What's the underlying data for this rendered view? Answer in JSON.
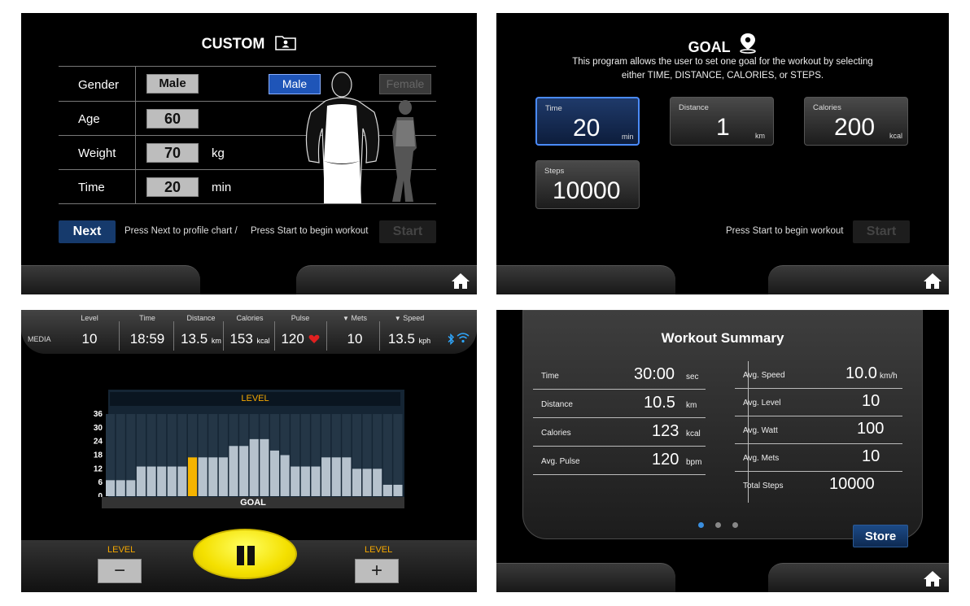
{
  "custom": {
    "title": "CUSTOM",
    "labels": {
      "gender": "Gender",
      "age": "Age",
      "weight": "Weight",
      "time": "Time"
    },
    "values": {
      "gender": "Male",
      "age": "60",
      "weight": "70",
      "time": "20"
    },
    "units": {
      "weight": "kg",
      "time": "min"
    },
    "gender_options": {
      "male": "Male",
      "female": "Female"
    },
    "next_label": "Next",
    "hint_next": "Press Next to profile chart  /",
    "hint_start": "Press Start to begin workout",
    "start_label": "Start"
  },
  "goal": {
    "title": "GOAL",
    "description_line1": "This program allows the user to set one goal for the workout by selecting",
    "description_line2": "either TIME, DISTANCE, CALORIES, or STEPS.",
    "cards": [
      {
        "label": "Time",
        "value": "20",
        "unit": "min",
        "selected": true
      },
      {
        "label": "Distance",
        "value": "1",
        "unit": "km",
        "selected": false
      },
      {
        "label": "Calories",
        "value": "200",
        "unit": "kcal",
        "selected": false
      },
      {
        "label": "Steps",
        "value": "10000",
        "unit": "",
        "selected": false
      }
    ],
    "hint_start": "Press Start to begin workout",
    "start_label": "Start"
  },
  "workout": {
    "media_label": "MEDIA",
    "stats": [
      {
        "label": "Level",
        "value": "10",
        "unit": ""
      },
      {
        "label": "Time",
        "value": "18:59",
        "unit": ""
      },
      {
        "label": "Distance",
        "value": "13.5",
        "unit": "km"
      },
      {
        "label": "Calories",
        "value": "153",
        "unit": "kcal"
      },
      {
        "label": "Pulse",
        "value": "120",
        "unit": ""
      },
      {
        "label": "Mets",
        "value": "10",
        "unit": ""
      },
      {
        "label": "Speed",
        "value": "13.5",
        "unit": "kph"
      }
    ],
    "chart_header": "LEVEL",
    "chart_footer": "GOAL",
    "y_ticks": [
      "36",
      "30",
      "24",
      "18",
      "12",
      "6",
      "0"
    ],
    "level_left_label": "LEVEL",
    "level_right_label": "LEVEL",
    "minus_label": "−",
    "plus_label": "+",
    "colors": {
      "bar": "#b6c2cd",
      "current": "#f5b400",
      "accent": "#f5a800"
    }
  },
  "chart_data": {
    "type": "bar",
    "y_ticks": [
      0,
      6,
      12,
      18,
      24,
      30,
      36
    ],
    "ylim": [
      0,
      36
    ],
    "values": [
      7,
      7,
      7,
      13,
      13,
      13,
      13,
      13,
      17,
      17,
      17,
      17,
      22,
      22,
      25,
      25,
      20,
      18,
      13,
      13,
      13,
      17,
      17,
      17,
      12,
      12,
      12,
      5,
      5
    ],
    "current_index": 8,
    "title": "LEVEL",
    "xlabel": "GOAL"
  },
  "summary": {
    "title": "Workout Summary",
    "left_rows": [
      {
        "label": "Time",
        "value": "30:00",
        "unit": "sec"
      },
      {
        "label": "Distance",
        "value": "10.5",
        "unit": "km"
      },
      {
        "label": "Calories",
        "value": "123",
        "unit": "kcal"
      },
      {
        "label": "Avg. Pulse",
        "value": "120",
        "unit": "bpm"
      }
    ],
    "right_rows": [
      {
        "label": "Avg. Speed",
        "value": "10.0",
        "unit": "km/h"
      },
      {
        "label": "Avg. Level",
        "value": "10",
        "unit": ""
      },
      {
        "label": "Avg. Watt",
        "value": "100",
        "unit": ""
      },
      {
        "label": "Avg. Mets",
        "value": "10",
        "unit": ""
      },
      {
        "label": "Total Steps",
        "value": "10000",
        "unit": ""
      }
    ],
    "store_label": "Store"
  }
}
